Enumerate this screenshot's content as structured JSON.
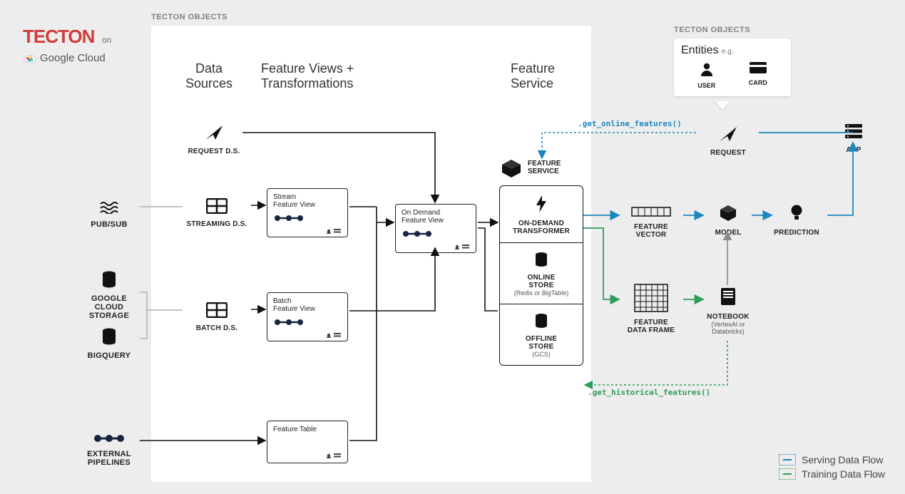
{
  "brand": {
    "tecton": "TECTON",
    "on": "on",
    "gcloud": "Google Cloud"
  },
  "section_labels": {
    "tecton_objects": "TECTON OBJECTS"
  },
  "columns": {
    "sources": "Data\nSources",
    "fv": "Feature Views +\nTransformations",
    "service": "Feature\nService"
  },
  "external_sources": {
    "pubsub": "PUB/SUB",
    "gcs": "GOOGLE\nCLOUD\nSTORAGE",
    "bigquery": "BIGQUERY",
    "external_pipelines": "EXTERNAL\nPIPELINES"
  },
  "data_sources": {
    "request": "REQUEST D.S.",
    "streaming": "STREAMING D.S.",
    "batch": "BATCH D.S."
  },
  "feature_views": {
    "stream": {
      "line1": "Stream",
      "line2": "Feature View"
    },
    "batch": {
      "line1": "Batch",
      "line2": "Feature View"
    },
    "ondemand": {
      "line1": "On Demand",
      "line2": "Feature View"
    },
    "table": {
      "line1": "Feature Table",
      "line2": ""
    }
  },
  "service": {
    "title": "FEATURE\nSERVICE",
    "ondemand": "ON-DEMAND\nTRANSFORMER",
    "online": {
      "label": "ONLINE\nSTORE",
      "sub": "(Redis or BigTable)"
    },
    "offline": {
      "label": "OFFLINE\nSTORE",
      "sub": "(GCS)"
    }
  },
  "outputs": {
    "feature_vector": "FEATURE\nVECTOR",
    "model": "MODEL",
    "prediction": "PREDICTION",
    "feature_df": "FEATURE\nDATA FRAME",
    "notebook": {
      "label": "NOTEBOOK",
      "sub": "(VertexAI or\nDatabricks)"
    },
    "request": "REQUEST",
    "app": "APP"
  },
  "entities": {
    "title": "Entities",
    "eg": "e.g.",
    "user": "USER",
    "card": "CARD"
  },
  "methods": {
    "online": ".get_online_features()",
    "historical": ".get_historical_features()"
  },
  "legend": {
    "serving": "Serving Data Flow",
    "training": "Training Data Flow"
  }
}
